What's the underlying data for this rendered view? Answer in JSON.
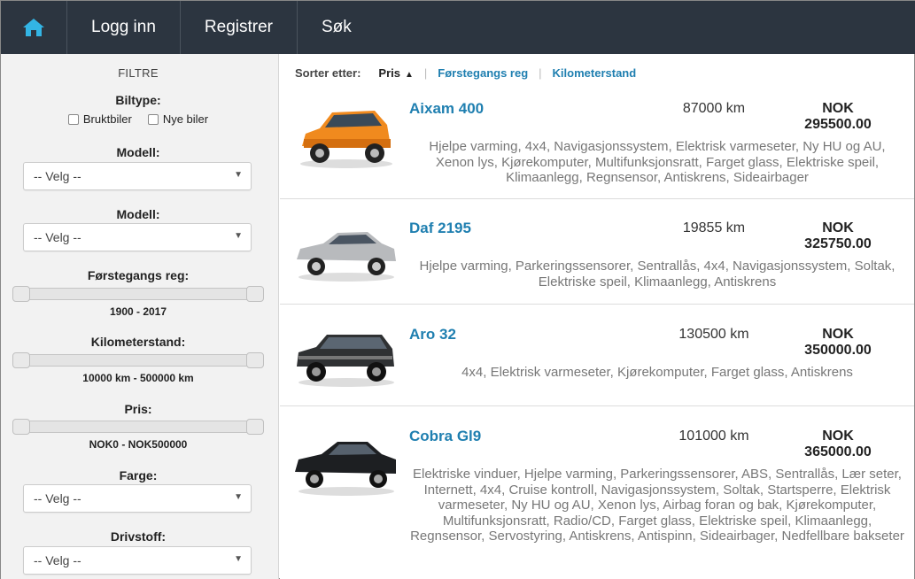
{
  "nav": {
    "home_icon": "home-icon",
    "items": [
      {
        "label": "Logg inn"
      },
      {
        "label": "Registrer"
      },
      {
        "label": "Søk"
      }
    ],
    "colors": {
      "bar": "#2c3540",
      "home_icon": "#33b5e5"
    }
  },
  "sidebar": {
    "title": "FILTRE",
    "biltype": {
      "label": "Biltype:",
      "options": [
        {
          "label": "Bruktbiler",
          "checked": false
        },
        {
          "label": "Nye biler",
          "checked": false
        }
      ]
    },
    "modell1": {
      "label": "Modell:",
      "value": "-- Velg --"
    },
    "modell2": {
      "label": "Modell:",
      "value": "-- Velg --"
    },
    "forstegangs": {
      "label": "Førstegangs reg:",
      "range": "1900 - 2017"
    },
    "kilometer": {
      "label": "Kilometerstand:",
      "range": "10000 km - 500000 km"
    },
    "pris": {
      "label": "Pris:",
      "range": "NOK0 - NOK500000"
    },
    "farge": {
      "label": "Farge:",
      "value": "-- Velg --"
    },
    "drivstoff": {
      "label": "Drivstoff:",
      "value": "-- Velg --"
    }
  },
  "sort": {
    "label": "Sorter etter:",
    "active": "Pris",
    "links": [
      "Førstegangs reg",
      "Kilometerstand"
    ]
  },
  "listings": [
    {
      "title": "Aixam 400",
      "km": "87000 km",
      "price_currency": "NOK",
      "price_value": "295500.00",
      "features": "Hjelpe varming, 4x4, Navigasjonssystem, Elektrisk varmeseter, Ny HU og AU, Xenon lys, Kjørekomputer, Multifunksjonsratt, Farget glass, Elektriske speil, Klimaanlegg, Regnsensor, Antiskrens, Sideairbager",
      "car_color": "#f08a1e"
    },
    {
      "title": "Daf 2195",
      "km": "19855 km",
      "price_currency": "NOK",
      "price_value": "325750.00",
      "features": "Hjelpe varming, Parkeringssensorer, Sentrallås, 4x4, Navigasjonssystem, Soltak, Elektriske speil, Klimaanlegg, Antiskrens",
      "car_color": "#b8babd"
    },
    {
      "title": "Aro 32",
      "km": "130500 km",
      "price_currency": "NOK",
      "price_value": "350000.00",
      "features": "4x4, Elektrisk varmeseter, Kjørekomputer, Farget glass, Antiskrens",
      "car_color": "#2f3133"
    },
    {
      "title": "Cobra Gl9",
      "km": "101000 km",
      "price_currency": "NOK",
      "price_value": "365000.00",
      "features": "Elektriske vinduer, Hjelpe varming, Parkeringssensorer, ABS, Sentrallås, Lær seter, Internett, 4x4, Cruise kontroll, Navigasjonssystem, Soltak, Startsperre, Elektrisk varmeseter, Ny HU og AU, Xenon lys, Airbag foran og bak, Kjørekomputer, Multifunksjonsratt, Radio/CD, Farget glass, Elektriske speil, Klimaanlegg, Regnsensor, Servostyring, Antiskrens, Antispinn, Sideairbager, Nedfellbare bakseter",
      "car_color": "#1d1f22"
    }
  ]
}
